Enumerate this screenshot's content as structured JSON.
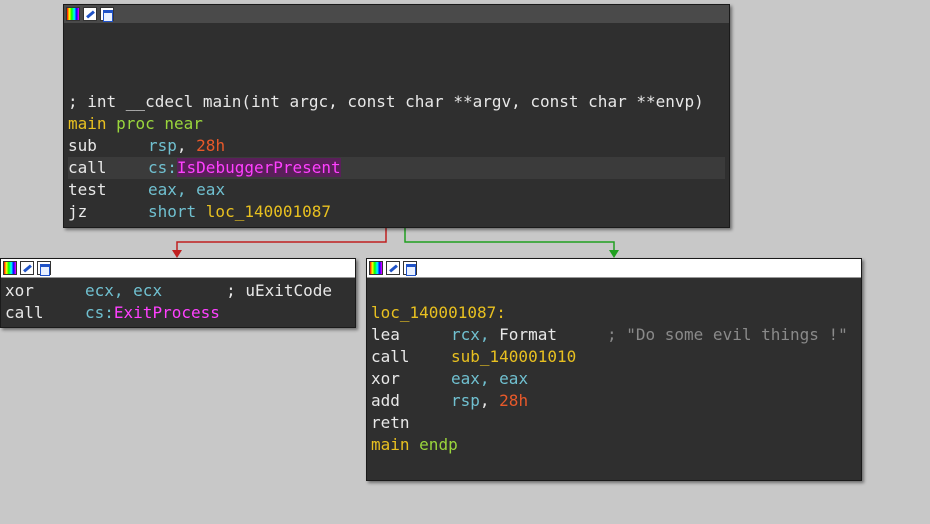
{
  "colors": {
    "background": "#c8c8c8",
    "node_bg": "#2f2f2f",
    "register": "#70c0d0",
    "number": "#e8592a",
    "label": "#e8c020",
    "keyword": "#9ad63c",
    "import": "#ff40ff",
    "edge_false": "#c02020",
    "edge_true": "#20a020"
  },
  "icons": [
    "color-icon",
    "pencil-icon",
    "graph-icon"
  ],
  "node_main": {
    "comment": "; int __cdecl main(int argc, const char **argv, const char **envp)",
    "proc_name": "main",
    "proc_kw": "proc near",
    "lines": [
      {
        "mnem": "sub",
        "op1": "rsp",
        "sep": ", ",
        "op2": "28h"
      },
      {
        "mnem": "call",
        "prefix": "cs:",
        "target": "IsDebuggerPresent"
      },
      {
        "mnem": "test",
        "op1": "eax",
        "sep": ", ",
        "op2": "eax"
      },
      {
        "mnem": "jz",
        "kw": "short ",
        "target": "loc_140001087"
      }
    ]
  },
  "node_exit": {
    "lines": [
      {
        "mnem": "xor",
        "op1": "ecx",
        "sep": ", ",
        "op2": "ecx",
        "comment": "; uExitCode"
      },
      {
        "mnem": "call",
        "prefix": "cs:",
        "target": "ExitProcess"
      }
    ]
  },
  "node_loc": {
    "label": "loc_140001087:",
    "lines": [
      {
        "mnem": "lea",
        "op1": "rcx",
        "sep": ", ",
        "op2": "Format",
        "comment": "; \"Do some evil things !\""
      },
      {
        "mnem": "call",
        "target": "sub_140001010"
      },
      {
        "mnem": "xor",
        "op1": "eax",
        "sep": ", ",
        "op2": "eax"
      },
      {
        "mnem": "add",
        "op1": "rsp",
        "sep": ", ",
        "op2": "28h"
      },
      {
        "mnem": "retn"
      }
    ],
    "endp_name": "main",
    "endp_kw": "endp"
  }
}
